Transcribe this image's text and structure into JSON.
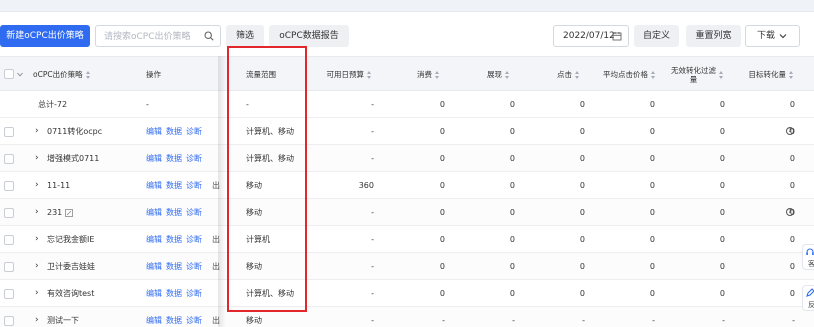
{
  "toolbar": {
    "new_label": "新建oCPC出价策略",
    "search_placeholder": "请搜索oCPC出价策略",
    "filter_label": "筛选",
    "report_label": "oCPC数据报告",
    "date": "2022/07/12",
    "custom_label": "自定义",
    "reset_cols_label": "重置列宽",
    "download_label": "下载"
  },
  "table": {
    "headers": {
      "name": "oCPC出价策略",
      "ops": "操作",
      "scope": "流量范围",
      "budget": "可用日预算",
      "cost": "消费",
      "impressions": "展现",
      "clicks": "点击",
      "avg_price": "平均点击价格",
      "invalid_line1": "无效转化过滤",
      "invalid_line2": "量",
      "target_conv": "目标转化量"
    },
    "ops_labels": {
      "edit": "编辑",
      "data": "数据",
      "diagnose": "诊断"
    },
    "total": {
      "name": "总计-72",
      "ops": "-",
      "scope": "-",
      "budget": "-",
      "cost": "0",
      "impressions": "0",
      "clicks": "0",
      "avg_price": "0",
      "invalid": "0",
      "target_conv": "0"
    },
    "rows": [
      {
        "name": "0711转化ocpc",
        "clipped": "",
        "scope": "计算机、移动",
        "budget": "-",
        "cost": "0",
        "impressions": "0",
        "clicks": "0",
        "avg_price": "0",
        "invalid": "0",
        "target_conv": "0",
        "help": "?"
      },
      {
        "name": "增强模式0711",
        "clipped": "",
        "scope": "计算机、移动",
        "budget": "-",
        "cost": "0",
        "impressions": "0",
        "clicks": "0",
        "avg_price": "0",
        "invalid": "0",
        "target_conv": "0",
        "help": ""
      },
      {
        "name": "11-11",
        "clipped": "出",
        "scope": "移动",
        "budget": "360",
        "cost": "0",
        "impressions": "0",
        "clicks": "0",
        "avg_price": "0",
        "invalid": "0",
        "target_conv": "0",
        "help": ""
      },
      {
        "name": "231",
        "clipped": "",
        "scope": "移动",
        "budget": "-",
        "cost": "0",
        "impressions": "0",
        "clicks": "0",
        "avg_price": "0",
        "invalid": "0",
        "target_conv": "0",
        "help": "?"
      },
      {
        "name": "忘记我金额IE",
        "clipped": "出",
        "scope": "计算机",
        "budget": "-",
        "cost": "0",
        "impressions": "0",
        "clicks": "0",
        "avg_price": "0",
        "invalid": "0",
        "target_conv": "0",
        "help": ""
      },
      {
        "name": "卫计委吉娃娃",
        "clipped": "出",
        "scope": "移动",
        "budget": "-",
        "cost": "0",
        "impressions": "0",
        "clicks": "0",
        "avg_price": "0",
        "invalid": "0",
        "target_conv": "0",
        "help": ""
      },
      {
        "name": "有效咨询test",
        "clipped": "",
        "scope": "计算机、移动",
        "budget": "-",
        "cost": "0",
        "impressions": "0",
        "clicks": "0",
        "avg_price": "0",
        "invalid": "0",
        "target_conv": "0",
        "help": ""
      },
      {
        "name": "测试一下",
        "clipped": "出",
        "scope": "移动",
        "budget": "-",
        "cost": "-",
        "impressions": "-",
        "clicks": "-",
        "avg_price": "-",
        "invalid": "-",
        "target_conv": "-",
        "help": ""
      }
    ]
  },
  "float": {
    "service": "客",
    "feedback": "反"
  },
  "colors": {
    "primary": "#2f6bf0",
    "highlight": "#e3262b"
  },
  "icons": [
    "search-icon",
    "calendar-icon",
    "chevron-down-icon",
    "edit-icon",
    "help-icon",
    "headset-icon",
    "feedback-icon"
  ]
}
